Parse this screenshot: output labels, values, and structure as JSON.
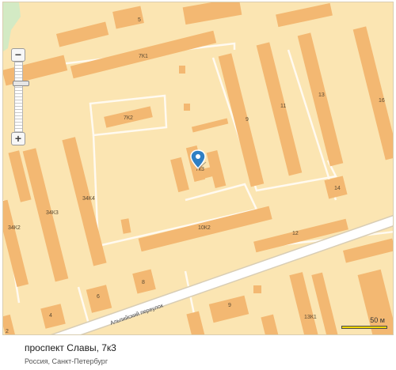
{
  "map": {
    "street_label": "Альпийский переулок",
    "scale_label": "50 м",
    "building_labels": [
      "5",
      "7К1",
      "7К2",
      "7к3",
      "9",
      "11",
      "13",
      "16",
      "34К4",
      "34К3",
      "34К2",
      "10К2",
      "12",
      "14",
      "8",
      "6",
      "4",
      "2",
      "9",
      "13К1"
    ],
    "colors": {
      "background": "#fbe5b2",
      "building": "#f3b872",
      "green": "#d3eac4",
      "road": "#ffffff",
      "block_outline": "#fffaf0",
      "marker": "#2f7fc4"
    }
  },
  "controls": {
    "zoom_in": "+",
    "zoom_out": "−",
    "zoom_level": 0.28
  },
  "caption": {
    "title": "проспект Славы, 7к3",
    "subtitle": "Россия, Санкт-Петербург"
  }
}
